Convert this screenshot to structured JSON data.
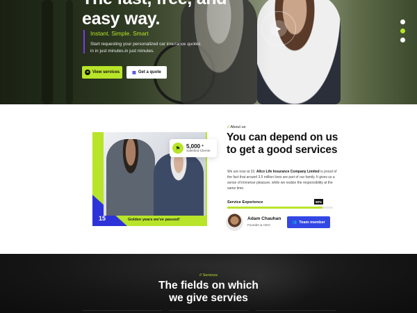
{
  "hero": {
    "title_line1": "The fast, free, and",
    "title_line2": "easy way.",
    "tagline": "Instant. Simple. Smart",
    "description": "Start requesting your personalized car insurance quotes in in just minutes.in just minutes.",
    "primary_button": "View services",
    "secondary_button": "Get a quote",
    "slider_dots": 3,
    "active_dot": 2
  },
  "about": {
    "kicker": "About us",
    "title": "You can depend on us to get a good services",
    "description_prefix": "We are now at 33. ",
    "company_name": "Allco Life Insurance Company Limited",
    "description_suffix": " is proud of the fact that around 3.5 million lives are part of our family. It gives us a sense of immense pleasure, while we realize the responsibility at the same time.",
    "stat_value": "5,000",
    "stat_plus": "+",
    "stat_label": "Satisfied Clients",
    "years_value": "15",
    "years_label": "Golden years we've passed!",
    "skill_label": "Service Experience",
    "skill_percent_text": "90%",
    "skill_percent": 0.9,
    "person_name": "Adam Chauhan",
    "person_role": "Founder & CEO",
    "team_button": "Team member"
  },
  "services": {
    "kicker": "Services",
    "title_line1": "The fields on which",
    "title_line2": "we give servies"
  },
  "colors": {
    "accent": "#b8e42a",
    "brand_blue": "#3347e5",
    "dark": "#111111"
  }
}
